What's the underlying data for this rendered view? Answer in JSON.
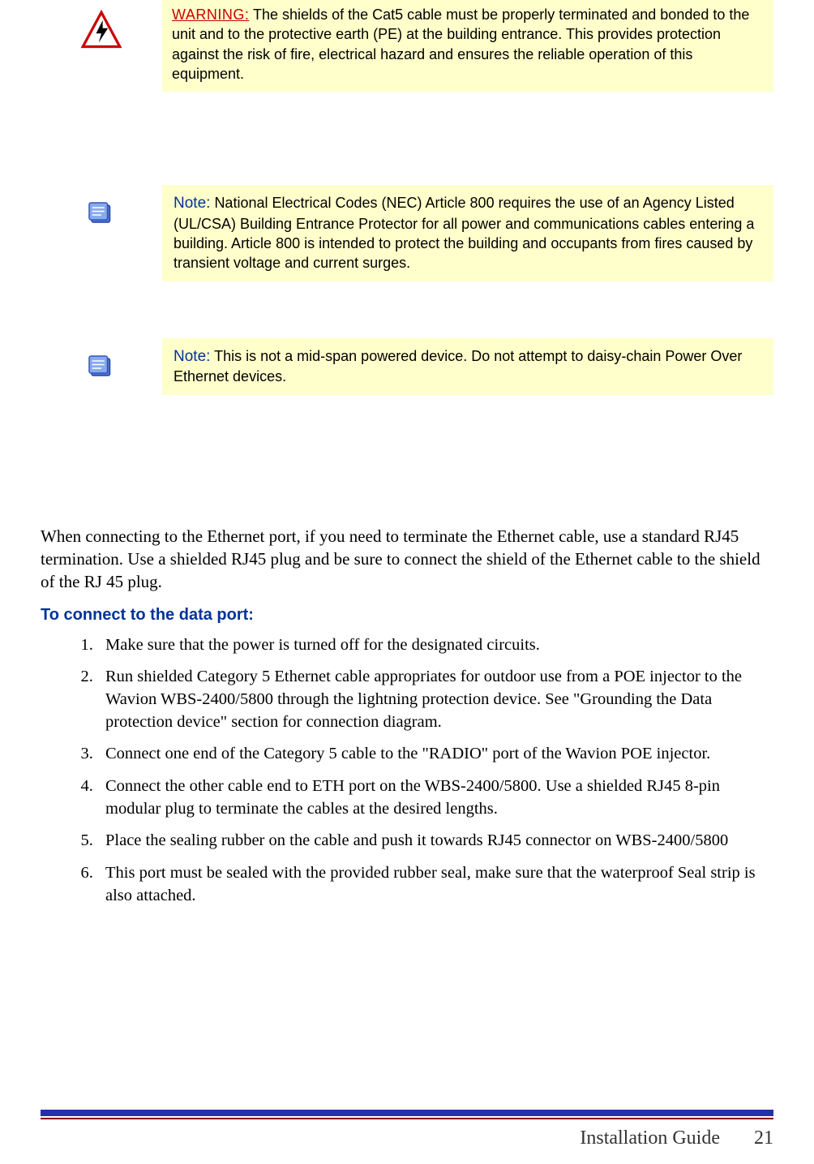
{
  "callouts": {
    "warning": {
      "label": "WARNING:",
      "text": "The shields of the Cat5 cable must be properly terminated and bonded to the unit and to the protective earth (PE) at the building entrance. This provides protection against the risk of fire, electrical hazard and ensures the reliable operation of this equipment."
    },
    "note1": {
      "label": "Note:",
      "text": "National Electrical Codes (NEC) Article 800 requires the use of an Agency Listed (UL/CSA) Building Entrance Protector for all power and communications cables entering a building. Article 800 is intended to protect the building and occupants from fires caused by transient voltage and current surges."
    },
    "note2": {
      "label": "Note:",
      "text": "This is not a mid-span powered device. Do not attempt to daisy-chain Power Over Ethernet devices."
    }
  },
  "body": {
    "para1": "When connecting to the Ethernet port, if you need to terminate the Ethernet cable, use a standard RJ45 termination. Use a shielded RJ45 plug and be sure to connect the shield of the Ethernet cable to the shield of the RJ 45 plug.",
    "heading": "To connect to the data port:",
    "steps": [
      "Make sure that the power is turned off for the designated circuits.",
      "Run shielded Category 5 Ethernet cable appropriates for outdoor use from a POE injector to the Wavion WBS-2400/5800 through the lightning protection device. See \"Grounding the Data protection device\" section for connection diagram.",
      "Connect one end of the Category 5 cable to the \"RADIO\" port of the Wavion POE injector.",
      "Connect the other cable end to ETH port on the WBS-2400/5800. Use a shielded RJ45 8-pin modular plug to terminate the cables at the desired lengths.",
      "Place the sealing rubber on the cable and push it towards RJ45 connector on WBS-2400/5800",
      "This port must be sealed with the provided rubber seal, make sure that the waterproof Seal strip is also attached."
    ]
  },
  "footer": {
    "title": "Installation Guide",
    "page": "21"
  }
}
